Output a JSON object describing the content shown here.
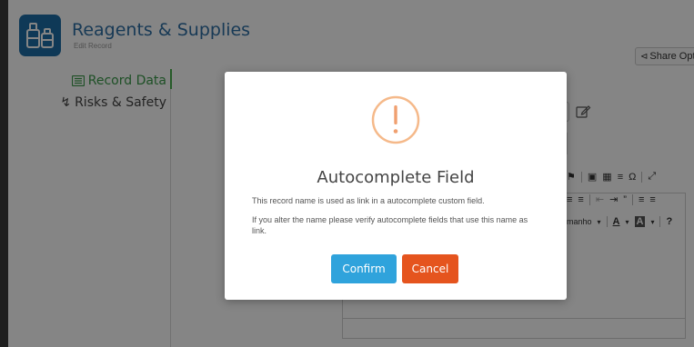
{
  "app": {
    "title": "Reagents & Supplies",
    "subtitle": "Edit Record",
    "share_label": "Share Opti"
  },
  "side_nav": {
    "items": [
      {
        "label": "Record Data",
        "icon": "list-icon",
        "active": true
      },
      {
        "label": "Risks & Safety",
        "icon": "bolt-icon",
        "active": false
      }
    ]
  },
  "editor_toolbar": {
    "row2_text": "",
    "row3_font_size_label": "manho",
    "row3_help": "?"
  },
  "modal": {
    "icon": "exclamation-icon",
    "title": "Autocomplete Field",
    "message_1": "This record name is used as link in a autocomplete custom field.",
    "message_2": "If you alter the name please verify autocomplete fields that use this name as link.",
    "confirm_label": "Confirm",
    "cancel_label": "Cancel"
  },
  "colors": {
    "brand_blue": "#1d6ea8",
    "title_blue": "#2f6fa5",
    "active_green": "#3a9a4a",
    "warning_orange": "#f5b98a",
    "confirm_blue": "#2fa3dc",
    "cancel_orange": "#e5541e"
  }
}
